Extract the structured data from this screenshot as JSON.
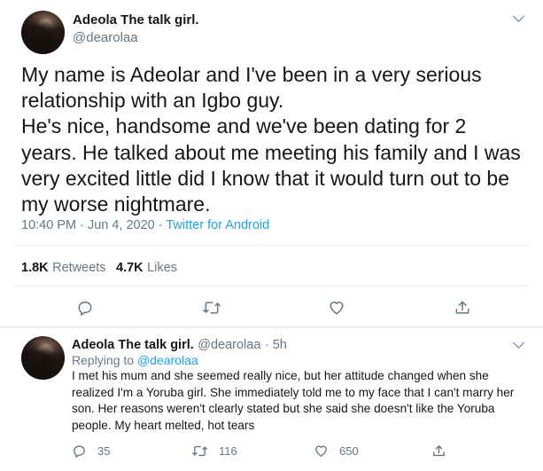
{
  "tweet": {
    "author_name": "Adeola The talk girl.",
    "author_handle": "@dearolaa",
    "text": "My name is Adeolar and I've been in a very serious relationship with an Igbo guy.\nHe's nice, handsome and we've been dating for 2 years. He talked about me meeting his family and I was very excited little did I know that it would turn out to be my worse nightmare.",
    "timestamp": "10:40 PM · Jun 4, 2020 · ",
    "source": "Twitter for Android",
    "retweets_count": "1.8K",
    "retweets_label": "Retweets",
    "likes_count": "4.7K",
    "likes_label": "Likes"
  },
  "reply": {
    "author_name": "Adeola The talk girl.",
    "author_handle": "@dearolaa",
    "age": "· 5h",
    "replying_to_label": "Replying to ",
    "replying_to_handle": "@dearolaa",
    "text": "I met his mum and she seemed really nice, but her attitude changed when she realized I'm a Yoruba girl. She immediately told me to my face that I can't marry her son. Her reasons weren't clearly stated but she said she doesn't like the Yoruba people. My heart melted, hot tears",
    "reply_count": "35",
    "retweet_count": "116",
    "like_count": "650"
  },
  "colors": {
    "accent": "#1da1f2",
    "secondary_text": "#657786",
    "divider": "#e6ecf0"
  },
  "icons": [
    "chevron-down-icon",
    "reply-icon",
    "retweet-icon",
    "like-icon",
    "share-icon"
  ]
}
